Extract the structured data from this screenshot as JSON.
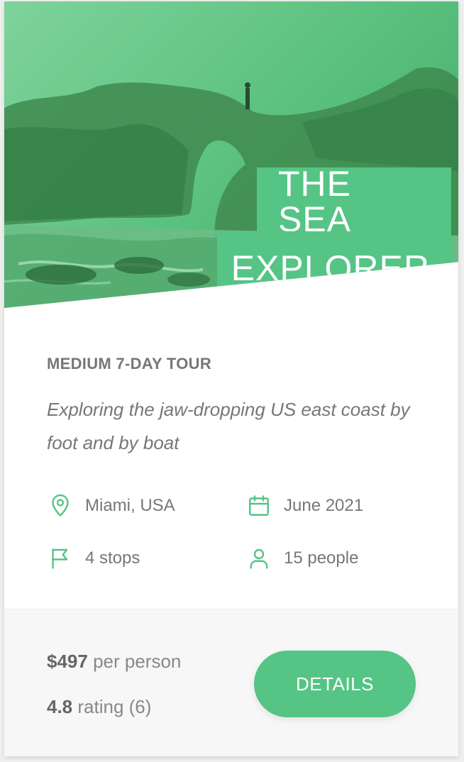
{
  "hero": {
    "title_line1": "THE SEA",
    "title_line2": "EXPLORER"
  },
  "tour": {
    "type": "MEDIUM 7-DAY TOUR",
    "description": "Exploring the jaw-dropping US east coast by foot and by boat"
  },
  "details": {
    "location": "Miami, USA",
    "date": "June 2021",
    "stops": "4 stops",
    "people": "15 people"
  },
  "footer": {
    "price_value": "$497",
    "price_suffix": "per person",
    "rating_value": "4.8",
    "rating_suffix": "rating (6)",
    "button_label": "DETAILS"
  },
  "colors": {
    "accent": "#55c485",
    "hero_overlay": "#7ed39a"
  },
  "icons": [
    "map-pin-icon",
    "calendar-icon",
    "flag-icon",
    "user-icon"
  ]
}
